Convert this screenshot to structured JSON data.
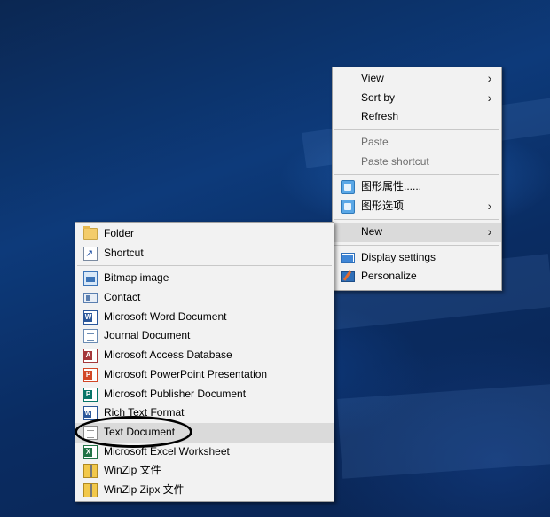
{
  "context_menu": {
    "items": [
      {
        "label": "View",
        "submenu": true
      },
      {
        "label": "Sort by",
        "submenu": true
      },
      {
        "label": "Refresh"
      },
      {
        "label": "Paste",
        "disabled": true
      },
      {
        "label": "Paste shortcut",
        "disabled": true
      },
      {
        "label": "图形属性......",
        "icon": "intel-graphics-icon"
      },
      {
        "label": "图形选项",
        "icon": "intel-graphics-icon",
        "submenu": true
      },
      {
        "label": "New",
        "submenu": true,
        "highlighted": true
      },
      {
        "label": "Display settings",
        "icon": "display-icon"
      },
      {
        "label": "Personalize",
        "icon": "personalize-icon"
      }
    ]
  },
  "new_submenu": {
    "items": [
      {
        "label": "Folder",
        "icon": "folder-icon"
      },
      {
        "label": "Shortcut",
        "icon": "shortcut-icon"
      },
      {
        "label": "Bitmap image",
        "icon": "bitmap-icon"
      },
      {
        "label": "Contact",
        "icon": "contact-icon"
      },
      {
        "label": "Microsoft Word Document",
        "icon": "word-icon"
      },
      {
        "label": "Journal Document",
        "icon": "journal-icon"
      },
      {
        "label": "Microsoft Access Database",
        "icon": "access-icon"
      },
      {
        "label": "Microsoft PowerPoint Presentation",
        "icon": "powerpoint-icon"
      },
      {
        "label": "Microsoft Publisher Document",
        "icon": "publisher-icon"
      },
      {
        "label": "Rich Text Format",
        "icon": "rtf-icon"
      },
      {
        "label": "Text Document",
        "icon": "text-document-icon",
        "highlighted": true
      },
      {
        "label": "Microsoft Excel Worksheet",
        "icon": "excel-icon"
      },
      {
        "label": "WinZip 文件",
        "icon": "winzip-icon"
      },
      {
        "label": "WinZip Zipx 文件",
        "icon": "winzip-icon"
      }
    ]
  },
  "colors": {
    "menu_background": "#f2f2f2",
    "highlight": "#dadada",
    "desktop": "#0d3a7a"
  }
}
